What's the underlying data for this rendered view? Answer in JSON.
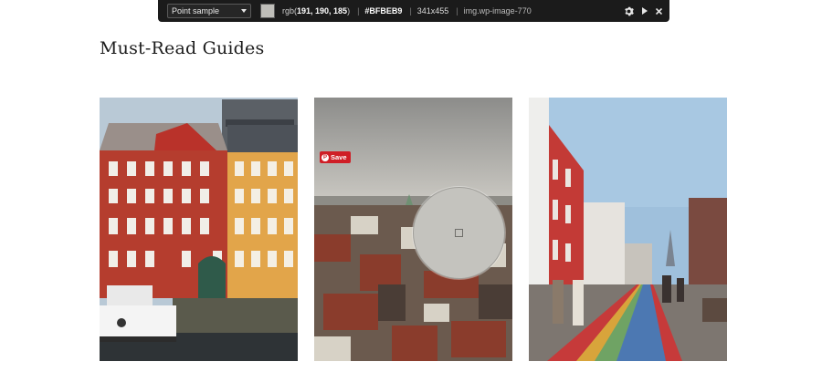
{
  "picker": {
    "mode": "Point sample",
    "rgb_prefix": "rgb(",
    "rgb_values": "191, 190, 185",
    "rgb_suffix": ")",
    "hex": "#BFBEB9",
    "size": "341x455",
    "separator": "|",
    "selector": "img.wp-image-770",
    "swatch_color": "#bfbeb9",
    "icons": [
      "gear-icon",
      "play-icon",
      "close-icon"
    ]
  },
  "page": {
    "title": "Must-Read Guides"
  },
  "cards": [
    {
      "name": "copenhagen-canal-houses"
    },
    {
      "name": "city-rooftops-cloudy",
      "save_label": "Save"
    },
    {
      "name": "rainbow-street"
    }
  ]
}
